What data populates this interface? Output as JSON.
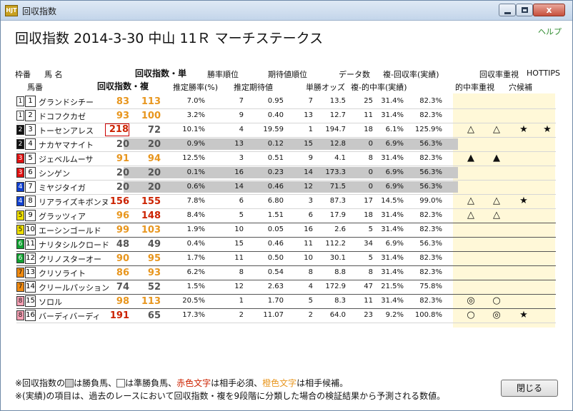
{
  "window": {
    "title": "回収指数",
    "icon_label": "HJT",
    "minimize": "",
    "maximize": "",
    "close": "x"
  },
  "header": {
    "title": "回収指数 2014-3-30 中山 11Ｒ マーチステークス",
    "help": "ヘルプ"
  },
  "columns": {
    "waku": "枠番",
    "uma_name": "馬 名",
    "umaban": "馬番",
    "index_tan": "回収指数・単",
    "index_fuku": "回収指数・複",
    "win_rank": "勝率順位",
    "win_rate": "推定勝率(%)",
    "exp_rank": "期待値順位",
    "exp_value": "推定期待値",
    "data_count": "データ数",
    "win_odds": "単勝オッズ",
    "fuku_return": "複-回収率(実績)",
    "fuku_hit": "複-的中率(実績)",
    "return_priority": "回収率重視",
    "hottips": "HOTTIPS",
    "hit_priority": "的中率重視",
    "hole": "穴候補"
  },
  "colors": {
    "tan_orange": "#e8961e",
    "fuku_red": "#cc2200",
    "gray_band": "#c8c8c8",
    "yellow_panel": "#fff8d8"
  },
  "horses": [
    {
      "waku": "1",
      "umaban": "1",
      "name": "グランドシチー",
      "tan": "83",
      "fuku": "113",
      "win_rate": "7.0%",
      "win_rank": "7",
      "exp": "0.95",
      "exp_rank": "7",
      "odds": "13.5",
      "count": "25",
      "hit": "31.4%",
      "ret": "82.3%",
      "m1": "",
      "m2": "",
      "m3": "",
      "m4": ""
    },
    {
      "waku": "1",
      "umaban": "2",
      "name": "ドコフクカゼ",
      "tan": "93",
      "fuku": "100",
      "win_rate": "3.2%",
      "win_rank": "9",
      "exp": "0.40",
      "exp_rank": "13",
      "odds": "12.7",
      "count": "11",
      "hit": "31.4%",
      "ret": "82.3%",
      "m1": "",
      "m2": "",
      "m3": "",
      "m4": ""
    },
    {
      "waku": "2",
      "umaban": "3",
      "name": "トーセンアレス",
      "tan": "218",
      "fuku": "72",
      "win_rate": "10.1%",
      "win_rank": "4",
      "exp": "19.59",
      "exp_rank": "1",
      "odds": "194.7",
      "count": "18",
      "hit": "6.1%",
      "ret": "125.9%",
      "m1": "△",
      "m2": "△",
      "m3": "★",
      "m4": "★"
    },
    {
      "waku": "2",
      "umaban": "4",
      "name": "ナカヤマナイト",
      "tan": "20",
      "fuku": "20",
      "win_rate": "0.9%",
      "win_rank": "13",
      "exp": "0.12",
      "exp_rank": "15",
      "odds": "12.8",
      "count": "0",
      "hit": "6.9%",
      "ret": "56.3%",
      "m1": "",
      "m2": "",
      "m3": "",
      "m4": ""
    },
    {
      "waku": "3",
      "umaban": "5",
      "name": "ジェベルムーサ",
      "tan": "91",
      "fuku": "94",
      "win_rate": "12.5%",
      "win_rank": "3",
      "exp": "0.51",
      "exp_rank": "9",
      "odds": "4.1",
      "count": "8",
      "hit": "31.4%",
      "ret": "82.3%",
      "m1": "▲",
      "m2": "▲",
      "m3": "",
      "m4": ""
    },
    {
      "waku": "3",
      "umaban": "6",
      "name": "シンゲン",
      "tan": "20",
      "fuku": "20",
      "win_rate": "0.1%",
      "win_rank": "16",
      "exp": "0.23",
      "exp_rank": "14",
      "odds": "173.3",
      "count": "0",
      "hit": "6.9%",
      "ret": "56.3%",
      "m1": "",
      "m2": "",
      "m3": "",
      "m4": ""
    },
    {
      "waku": "4",
      "umaban": "7",
      "name": "ミヤジタイガ",
      "tan": "20",
      "fuku": "20",
      "win_rate": "0.6%",
      "win_rank": "14",
      "exp": "0.46",
      "exp_rank": "12",
      "odds": "71.5",
      "count": "0",
      "hit": "6.9%",
      "ret": "56.3%",
      "m1": "",
      "m2": "",
      "m3": "",
      "m4": ""
    },
    {
      "waku": "4",
      "umaban": "8",
      "name": "リアライズキボンヌ",
      "tan": "156",
      "fuku": "155",
      "win_rate": "7.8%",
      "win_rank": "6",
      "exp": "6.80",
      "exp_rank": "3",
      "odds": "87.3",
      "count": "17",
      "hit": "14.5%",
      "ret": "99.0%",
      "m1": "△",
      "m2": "△",
      "m3": "★",
      "m4": ""
    },
    {
      "waku": "5",
      "umaban": "9",
      "name": "グラッツィア",
      "tan": "96",
      "fuku": "148",
      "win_rate": "8.4%",
      "win_rank": "5",
      "exp": "1.51",
      "exp_rank": "6",
      "odds": "17.9",
      "count": "18",
      "hit": "31.4%",
      "ret": "82.3%",
      "m1": "△",
      "m2": "△",
      "m3": "",
      "m4": ""
    },
    {
      "waku": "5",
      "umaban": "10",
      "name": "エーシンゴールド",
      "tan": "99",
      "fuku": "103",
      "win_rate": "1.9%",
      "win_rank": "10",
      "exp": "0.05",
      "exp_rank": "16",
      "odds": "2.6",
      "count": "5",
      "hit": "31.4%",
      "ret": "82.3%",
      "m1": "",
      "m2": "",
      "m3": "",
      "m4": ""
    },
    {
      "waku": "6",
      "umaban": "11",
      "name": "ナリタシルクロード",
      "tan": "48",
      "fuku": "49",
      "win_rate": "0.4%",
      "win_rank": "15",
      "exp": "0.46",
      "exp_rank": "11",
      "odds": "112.2",
      "count": "34",
      "hit": "6.9%",
      "ret": "56.3%",
      "m1": "",
      "m2": "",
      "m3": "",
      "m4": ""
    },
    {
      "waku": "6",
      "umaban": "12",
      "name": "クリノスターオー",
      "tan": "90",
      "fuku": "95",
      "win_rate": "1.7%",
      "win_rank": "11",
      "exp": "0.50",
      "exp_rank": "10",
      "odds": "30.1",
      "count": "5",
      "hit": "31.4%",
      "ret": "82.3%",
      "m1": "",
      "m2": "",
      "m3": "",
      "m4": ""
    },
    {
      "waku": "7",
      "umaban": "13",
      "name": "クリソライト",
      "tan": "86",
      "fuku": "93",
      "win_rate": "6.2%",
      "win_rank": "8",
      "exp": "0.54",
      "exp_rank": "8",
      "odds": "8.8",
      "count": "8",
      "hit": "31.4%",
      "ret": "82.3%",
      "m1": "",
      "m2": "",
      "m3": "",
      "m4": ""
    },
    {
      "waku": "7",
      "umaban": "14",
      "name": "クリールパッション",
      "tan": "74",
      "fuku": "52",
      "win_rate": "1.5%",
      "win_rank": "12",
      "exp": "2.63",
      "exp_rank": "4",
      "odds": "172.9",
      "count": "47",
      "hit": "21.5%",
      "ret": "75.8%",
      "m1": "",
      "m2": "",
      "m3": "",
      "m4": ""
    },
    {
      "waku": "8",
      "umaban": "15",
      "name": "ソロル",
      "tan": "98",
      "fuku": "113",
      "win_rate": "20.5%",
      "win_rank": "1",
      "exp": "1.70",
      "exp_rank": "5",
      "odds": "8.3",
      "count": "11",
      "hit": "31.4%",
      "ret": "82.3%",
      "m1": "◎",
      "m2": "○",
      "m3": "",
      "m4": ""
    },
    {
      "waku": "8",
      "umaban": "16",
      "name": "バーディバーディ",
      "tan": "191",
      "fuku": "65",
      "win_rate": "17.3%",
      "win_rank": "2",
      "exp": "11.07",
      "exp_rank": "2",
      "odds": "64.0",
      "count": "23",
      "hit": "9.2%",
      "ret": "100.8%",
      "m1": "○",
      "m2": "◎",
      "m3": "★",
      "m4": ""
    }
  ],
  "footnotes": {
    "line1_a": "※回収指数の",
    "line1_b": "は勝負馬、",
    "line1_c": "は準勝負馬、",
    "line1_red": "赤色文字",
    "line1_d": "は相手必須、",
    "line1_orange": "橙色文字",
    "line1_e": "は相手候補。",
    "line2": "※(実績)の項目は、過去のレースにおいて回収指数・複を9段階に分類した場合の検証結果から予測される数値。"
  },
  "buttons": {
    "close": "閉じる"
  }
}
